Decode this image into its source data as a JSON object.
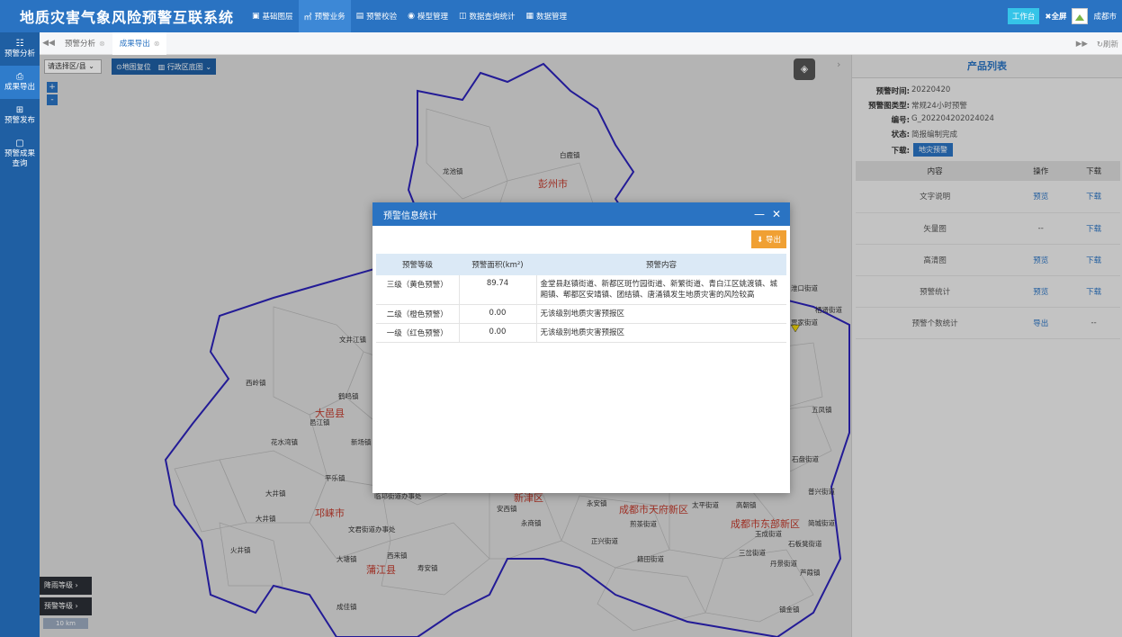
{
  "app": {
    "title": "地质灾害气象风险预警互联系统",
    "nav": [
      {
        "icon": "▣",
        "label": "基础图层"
      },
      {
        "icon": "㎡",
        "label": "预警业务"
      },
      {
        "icon": "▤",
        "label": "预警校验"
      },
      {
        "icon": "◉",
        "label": "模型管理"
      },
      {
        "icon": "◫",
        "label": "数据查询统计"
      },
      {
        "icon": "▦",
        "label": "数据管理"
      }
    ],
    "workbench": "工作台",
    "fullscreen": "全屏",
    "city": "成都市"
  },
  "sidebar": [
    {
      "icon": "☷",
      "label1": "预警分析",
      "label2": ""
    },
    {
      "icon": "⎙",
      "label1": "成果导出",
      "label2": ""
    },
    {
      "icon": "⊞",
      "label1": "预警发布",
      "label2": ""
    },
    {
      "icon": "▢",
      "label1": "预警成果",
      "label2": "查询"
    }
  ],
  "tabs": [
    {
      "label": "预警分析"
    },
    {
      "label": "成果导出"
    }
  ],
  "tabbar": {
    "refresh": "刷新"
  },
  "map": {
    "region_select": "请选择区/县",
    "tools": [
      "地图复位",
      "行政区底图"
    ],
    "zoom_in": "+",
    "zoom_out": "-",
    "legend": [
      "降雨等级",
      "预警等级"
    ],
    "scale": "10 km",
    "labels": [
      {
        "text": "龙池镇",
        "red": false
      },
      {
        "text": "白鹿镇",
        "red": false
      },
      {
        "text": "彭州市",
        "red": true
      },
      {
        "text": "文井江镇",
        "red": false
      },
      {
        "text": "西岭镇",
        "red": false
      },
      {
        "text": "大邑县",
        "red": true
      },
      {
        "text": "鹤鸣镇",
        "red": false
      },
      {
        "text": "邑江镇",
        "red": false
      },
      {
        "text": "花水湾镇",
        "red": false
      },
      {
        "text": "新场镇",
        "red": false
      },
      {
        "text": "平乐镇",
        "red": false
      },
      {
        "text": "临邛街道办事处",
        "red": false
      },
      {
        "text": "大井镇",
        "red": false
      },
      {
        "text": "邛崃市",
        "red": true
      },
      {
        "text": "大井镇",
        "red": false
      },
      {
        "text": "文君街道办事处",
        "red": false
      },
      {
        "text": "火井镇",
        "red": false
      },
      {
        "text": "大塘镇",
        "red": false
      },
      {
        "text": "西来镇",
        "red": false
      },
      {
        "text": "蒲江县",
        "red": true
      },
      {
        "text": "寿安镇",
        "red": false
      },
      {
        "text": "成佳镇",
        "red": false
      },
      {
        "text": "安西镇",
        "red": false
      },
      {
        "text": "新津区",
        "red": true
      },
      {
        "text": "永商镇",
        "red": false
      },
      {
        "text": "永安镇",
        "red": false
      },
      {
        "text": "成都市天府新区",
        "red": true
      },
      {
        "text": "煎茶街道",
        "red": false
      },
      {
        "text": "正兴街道",
        "red": false
      },
      {
        "text": "籍田街道",
        "red": false
      },
      {
        "text": "太平街道",
        "red": false
      },
      {
        "text": "高朝镇",
        "red": false
      },
      {
        "text": "成都市东部新区",
        "red": true
      },
      {
        "text": "玉成街道",
        "red": false
      },
      {
        "text": "三岔街道",
        "red": false
      },
      {
        "text": "丹景街道",
        "red": false
      },
      {
        "text": "芦葭镇",
        "red": false
      },
      {
        "text": "石盘街道",
        "red": false
      },
      {
        "text": "石板凳街道",
        "red": false
      },
      {
        "text": "简城街道",
        "red": false
      },
      {
        "text": "五凤镇",
        "red": false
      },
      {
        "text": "栖贤街道",
        "red": false
      },
      {
        "text": "淮口街道",
        "red": false
      },
      {
        "text": "贾家街道",
        "red": false
      },
      {
        "text": "镇金镇",
        "red": false
      },
      {
        "text": "普兴街道",
        "red": false
      }
    ]
  },
  "panel": {
    "title": "产品列表",
    "info": [
      {
        "key": "预警时间:",
        "val": "20220420"
      },
      {
        "key": "预警图类型:",
        "val": "常规24小时预警"
      },
      {
        "key": "编号:",
        "val": "G_202204202024024"
      },
      {
        "key": "状态:",
        "val": "简报编制完成"
      }
    ],
    "download_label": "下载:",
    "download_btn": "地灾预警",
    "table_headers": [
      "内容",
      "操作",
      "下载"
    ],
    "rows": [
      {
        "name": "文字说明",
        "op": "预览",
        "dl": "下载"
      },
      {
        "name": "矢量图",
        "op": "--",
        "dl": "下载"
      },
      {
        "name": "高清图",
        "op": "预览",
        "dl": "下载"
      },
      {
        "name": "预警统计",
        "op": "预览",
        "dl": "下载"
      },
      {
        "name": "预警个数统计",
        "op": "导出",
        "dl": "--"
      }
    ]
  },
  "modal": {
    "title": "预警信息统计",
    "minimize": "—",
    "close": "✕",
    "export": "导出",
    "headers": [
      "预警等级",
      "预警面积(km²)",
      "预警内容"
    ],
    "rows": [
      {
        "level": "三级（黄色预警）",
        "area": "89.74",
        "content": "金堂县赵镇街道、新都区斑竹园街道、新繁街道、青白江区姚渡镇、城厢镇、郫都区安靖镇、团结镇、唐涌镇发生地质灾害的风险较高"
      },
      {
        "level": "二级（橙色预警）",
        "area": "0.00",
        "content": "无该级别地质灾害预报区"
      },
      {
        "level": "一级（红色预警）",
        "area": "0.00",
        "content": "无该级别地质灾害预报区"
      }
    ]
  },
  "colors": {
    "topbar": "#2a73c2",
    "sidebar": "#1f5fa3",
    "export": "#f0a033",
    "boundary": "#2b22b8",
    "warning_yellow": "#f5d90a"
  }
}
